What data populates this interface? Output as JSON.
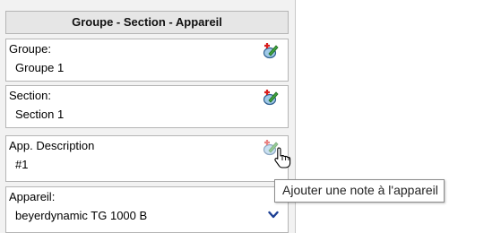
{
  "panel": {
    "title": "Groupe - Section - Appareil",
    "fields": [
      {
        "label": "Groupe:",
        "value": "Groupe 1",
        "icon": "add-note-icon"
      },
      {
        "label": "Section:",
        "value": "Section 1",
        "icon": "add-note-icon"
      },
      {
        "label": "App. Description",
        "value": "#1",
        "icon": "add-note-icon"
      },
      {
        "label": "Appareil:",
        "value": "beyerdynamic TG 1000 B",
        "icon": "chevron-down-icon"
      }
    ]
  },
  "tooltip": {
    "text": "Ajouter une note à l'appareil"
  },
  "colors": {
    "panel_bg": "#f2f2f2",
    "header_bg": "#e6e6e6",
    "border": "#b5b5b5",
    "chevron": "#1c3f94"
  }
}
